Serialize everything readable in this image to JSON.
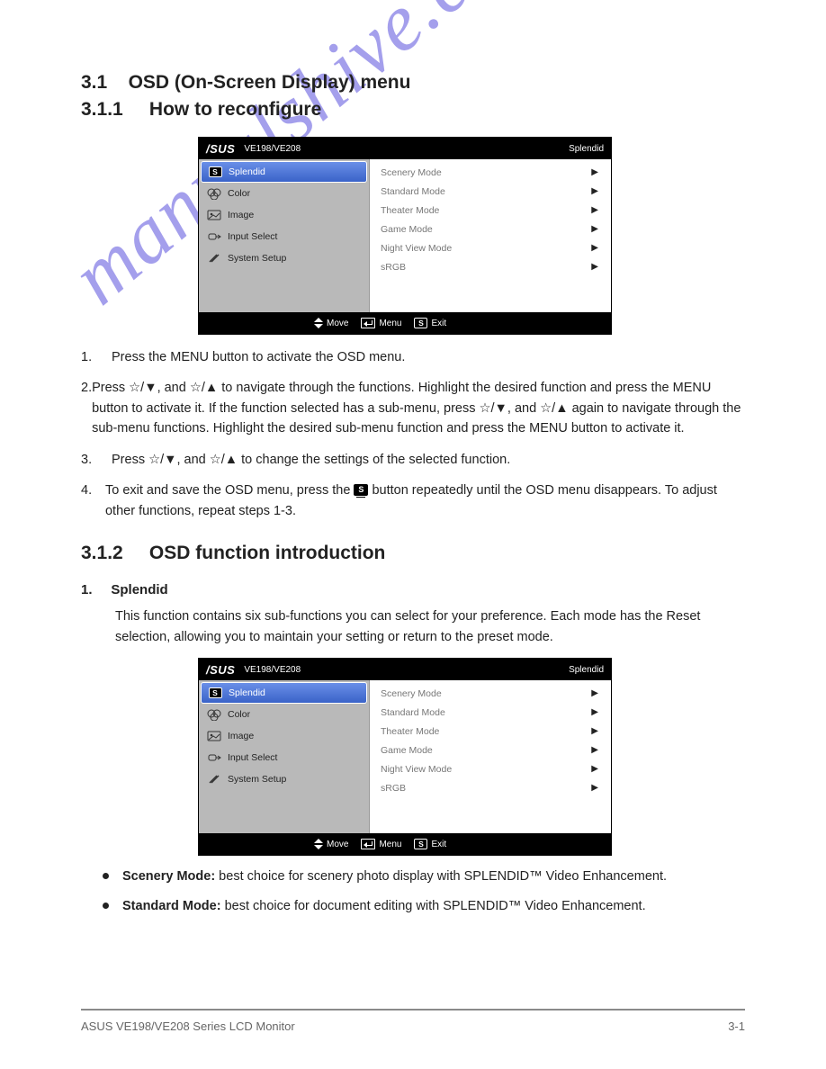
{
  "watermark": "manualshive.com",
  "section": {
    "number": "3.1",
    "title": "OSD (On-Screen Display) menu",
    "sub_number": "3.1.1",
    "sub_title": "How to reconfigure"
  },
  "osd1": {
    "brand": "/SUS",
    "model": "VE198/VE208",
    "right": "Splendid",
    "sidebar": [
      {
        "label": "Splendid",
        "selected": true,
        "icon": "s"
      },
      {
        "label": "Color",
        "icon": "rgb"
      },
      {
        "label": "Image",
        "icon": "image"
      },
      {
        "label": "Input Select",
        "icon": "input"
      },
      {
        "label": "System Setup",
        "icon": "tools"
      }
    ],
    "main": [
      "Scenery Mode",
      "Standard Mode",
      "Theater Mode",
      "Game Mode",
      "Night View Mode",
      "sRGB"
    ],
    "footer": {
      "move": "Move",
      "menu": "Menu",
      "exit": "Exit"
    }
  },
  "steps": [
    "Press the MENU button to activate the OSD menu.",
    "Press ☆/▼, and ☆/▲ to navigate through the functions. Highlight the desired function and press the MENU button to activate it. If the function selected has a sub-menu, press ☆/▼, and ☆/▲ again to navigate through the sub-menu functions. Highlight the desired sub-menu function and press the MENU button to activate it.",
    "Press ☆/▼, and ☆/▲ to change the settings of the selected function.",
    "To exit and save the OSD menu, press the  button repeatedly until the OSD menu disappears. To adjust other functions, repeat steps 1-3."
  ],
  "intro_section": {
    "number": "3.1.2",
    "title": "OSD function introduction",
    "heading_num": "1.",
    "heading_text": "Splendid",
    "para": "This function contains six sub-functions you can select for your preference. Each mode has the Reset selection, allowing you to maintain your setting or return to the preset mode."
  },
  "osd2": {
    "brand": "/SUS",
    "model": "VE198/VE208",
    "right": "Splendid",
    "sidebar": [
      {
        "label": "Splendid",
        "selected": true,
        "icon": "s"
      },
      {
        "label": "Color",
        "icon": "rgb"
      },
      {
        "label": "Image",
        "icon": "image"
      },
      {
        "label": "Input Select",
        "icon": "input"
      },
      {
        "label": "System Setup",
        "icon": "tools"
      }
    ],
    "main": [
      "Scenery Mode",
      "Standard Mode",
      "Theater Mode",
      "Game Mode",
      "Night View Mode",
      "sRGB"
    ],
    "footer": {
      "move": "Move",
      "menu": "Menu",
      "exit": "Exit"
    }
  },
  "bullets": [
    {
      "bold": "Scenery Mode:",
      "rest": " best choice for scenery photo display with SPLENDID™ Video Enhancement."
    },
    {
      "bold": "Standard Mode:",
      "rest": " best choice for document editing with SPLENDID™ Video Enhancement."
    }
  ],
  "footer": {
    "left": "ASUS VE198/VE208 Series LCD Monitor",
    "right": "3-1"
  }
}
